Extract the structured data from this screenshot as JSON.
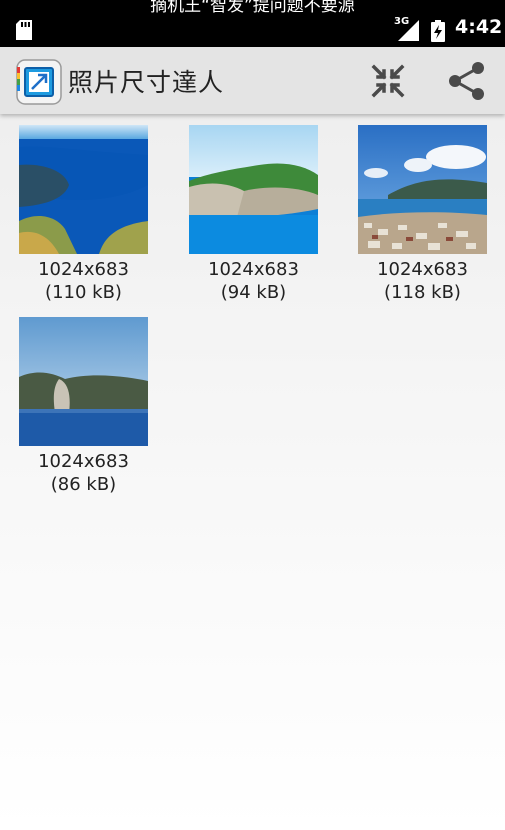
{
  "status_bar": {
    "notification": "摘机王“智发”提问题不要源",
    "network": "3G",
    "time": "4:42"
  },
  "action_bar": {
    "title": "照片尺寸達人",
    "icons": [
      "app-icon",
      "shrink-icon",
      "share-icon"
    ]
  },
  "photos": [
    {
      "dimensions": "1024x683",
      "size": "(110 kB)"
    },
    {
      "dimensions": "1024x683",
      "size": "(94 kB)"
    },
    {
      "dimensions": "1024x683",
      "size": "(118 kB)"
    },
    {
      "dimensions": "1024x683",
      "size": "(86 kB)"
    }
  ],
  "colors": {
    "status_bar": "#000000",
    "action_bar": "#e4e4e4",
    "accent_blue": "#1a73c8"
  }
}
